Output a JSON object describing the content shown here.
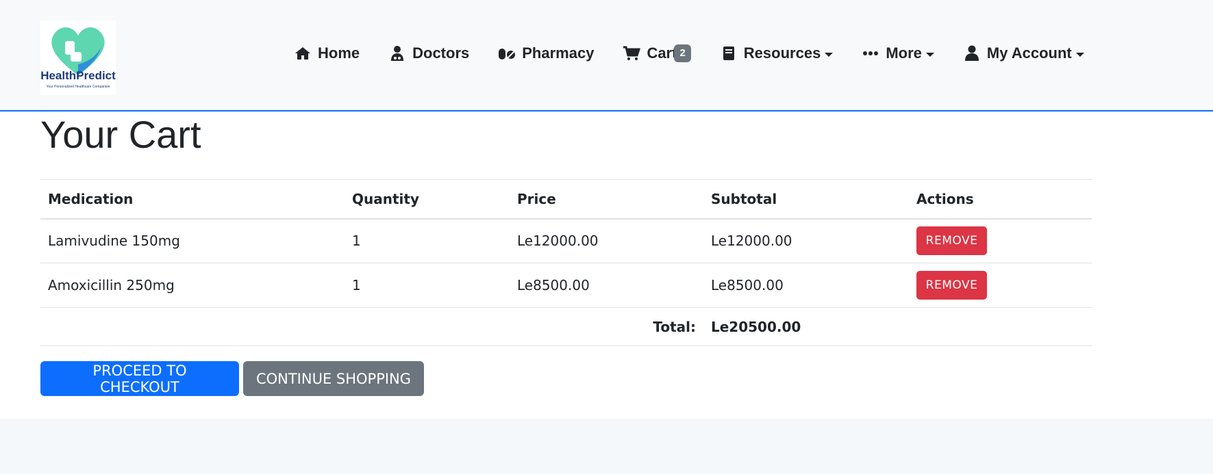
{
  "brand": {
    "logo_text": "HealthPredict",
    "logo_tagline": "Your Personalized Healthcare Companion"
  },
  "nav": {
    "home": "Home",
    "doctors": "Doctors",
    "pharmacy": "Pharmacy",
    "cart": "Cart",
    "cart_count": "2",
    "resources": "Resources",
    "more": "More",
    "account": "My Account"
  },
  "page": {
    "title": "Your Cart"
  },
  "table": {
    "headers": {
      "medication": "Medication",
      "quantity": "Quantity",
      "price": "Price",
      "subtotal": "Subtotal",
      "actions": "Actions"
    },
    "rows": [
      {
        "medication": "Lamivudine 150mg",
        "quantity": "1",
        "price": "Le12000.00",
        "subtotal": "Le12000.00",
        "action": "REMOVE"
      },
      {
        "medication": "Amoxicillin 250mg",
        "quantity": "1",
        "price": "Le8500.00",
        "subtotal": "Le8500.00",
        "action": "REMOVE"
      }
    ],
    "total_label": "Total:",
    "total_value": "Le20500.00"
  },
  "buttons": {
    "checkout": "PROCEED TO CHECKOUT",
    "continue": "CONTINUE SHOPPING"
  },
  "colors": {
    "primary": "#0d6efd",
    "secondary": "#6c757d",
    "danger": "#dc3545",
    "logo_teal": "#5ed6b0",
    "logo_blue": "#2f8fd8",
    "logo_navy": "#1f3a7a"
  }
}
